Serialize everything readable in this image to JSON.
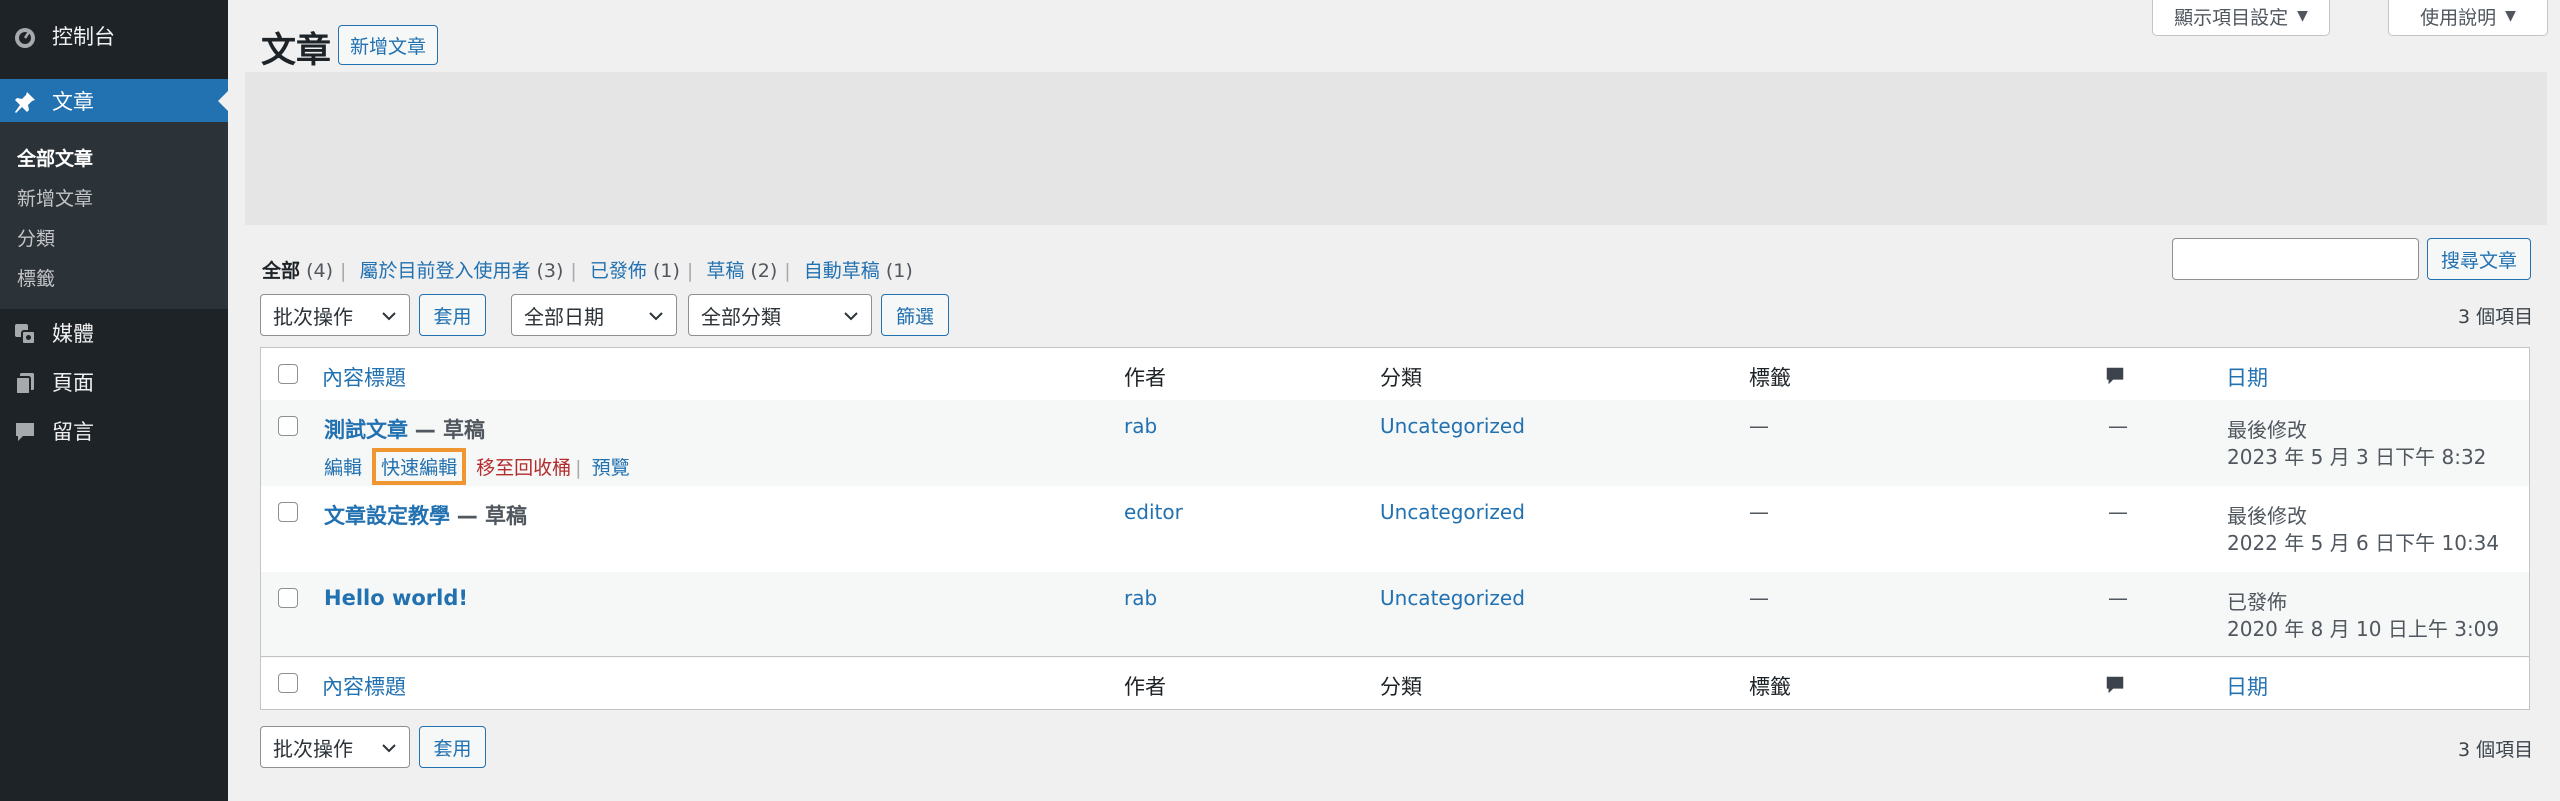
{
  "sidebar": {
    "dashboard": "控制台",
    "posts": "文章",
    "submenu": [
      "全部文章",
      "新增文章",
      "分類",
      "標籤"
    ],
    "media": "媒體",
    "pages": "頁面",
    "comments": "留言"
  },
  "header": {
    "title": "文章",
    "add_new": "新增文章",
    "screen_options": "顯示項目設定",
    "help": "使用說明"
  },
  "views": [
    {
      "label": "全部",
      "count": "(4)"
    },
    {
      "label": "屬於目前登入使用者",
      "count": "(3)"
    },
    {
      "label": "已發佈",
      "count": "(1)"
    },
    {
      "label": "草稿",
      "count": "(2)"
    },
    {
      "label": "自動草稿",
      "count": "(1)"
    }
  ],
  "search": {
    "button": "搜尋文章"
  },
  "filters": {
    "bulk_action": "批次操作",
    "apply": "套用",
    "date": "全部日期",
    "category": "全部分類",
    "filter": "篩選"
  },
  "item_count": "3 個項目",
  "columns": {
    "title": "內容標題",
    "author": "作者",
    "categories": "分類",
    "tags": "標籤",
    "date": "日期"
  },
  "rows": [
    {
      "title": "測試文章",
      "state": "— 草稿",
      "author": "rab",
      "category": "Uncategorized",
      "tags": "—",
      "comments": "—",
      "date_status": "最後修改",
      "date": "2023 年 5 月 3 日下午 8:32",
      "actions": {
        "edit": "編輯",
        "quick_edit": "快速編輯",
        "trash": "移至回收桶",
        "preview": "預覽"
      }
    },
    {
      "title": "文章設定教學",
      "state": "— 草稿",
      "author": "editor",
      "category": "Uncategorized",
      "tags": "—",
      "comments": "—",
      "date_status": "最後修改",
      "date": "2022 年 5 月 6 日下午 10:34"
    },
    {
      "title": "Hello world!",
      "state": "",
      "author": "rab",
      "category": "Uncategorized",
      "tags": "—",
      "comments": "—",
      "date_status": "已發佈",
      "date": "2020 年 8 月 10 日上午 3:09"
    }
  ],
  "colors": {
    "accent": "#2271b1",
    "highlight": "#ef9630",
    "sidebar": "#1d2327"
  }
}
